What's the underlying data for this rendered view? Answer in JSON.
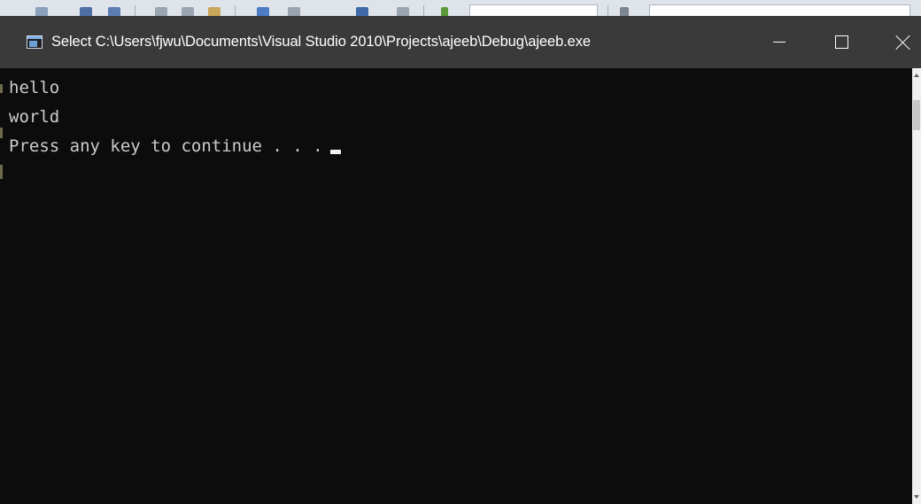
{
  "window": {
    "title": "Select C:\\Users\\fjwu\\Documents\\Visual Studio 2010\\Projects\\ajeeb\\Debug\\ajeeb.exe",
    "icon": "console-app-icon",
    "buttons": {
      "minimize_icon": "minimize-icon",
      "maximize_icon": "maximize-icon",
      "close_icon": "close-icon"
    }
  },
  "console": {
    "lines": [
      "hello",
      "world",
      "Press any key to continue . . ."
    ],
    "background_color": "#0c0c0c",
    "text_color": "#cccccc"
  },
  "colors": {
    "title_bar": "#3a3a3a",
    "console_bg": "#0c0c0c",
    "console_text": "#cccccc"
  }
}
